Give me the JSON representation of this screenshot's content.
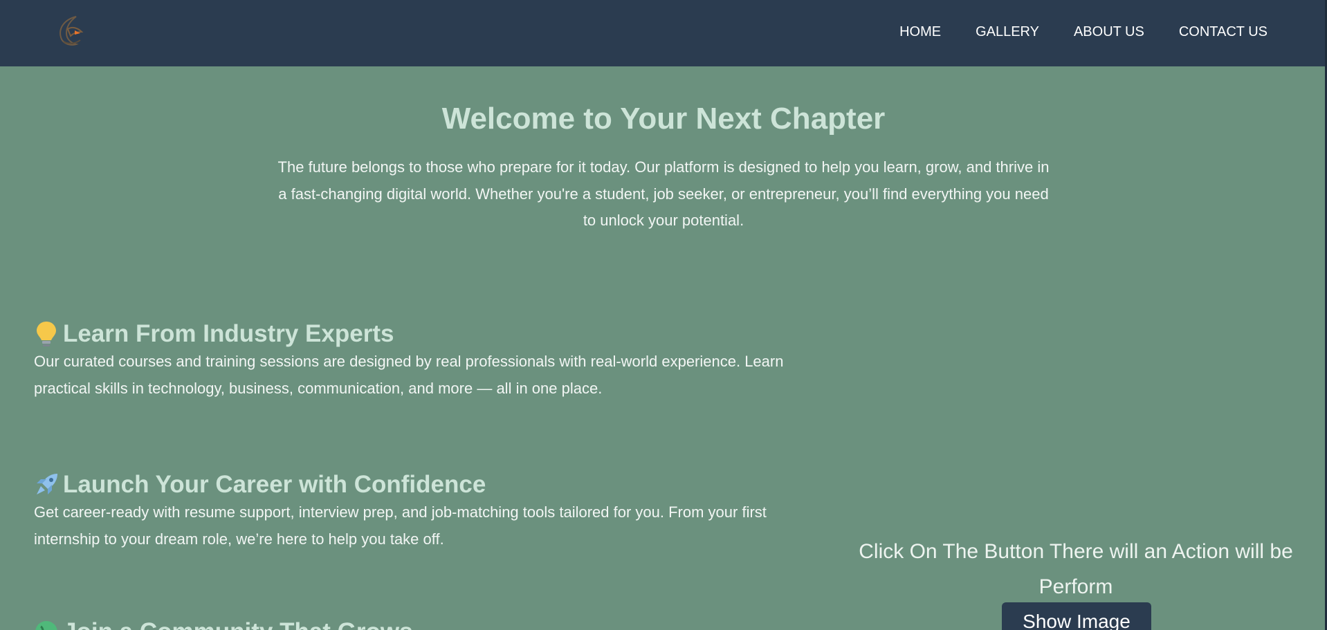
{
  "nav": {
    "items": [
      {
        "label": "HOME"
      },
      {
        "label": "GALLERY"
      },
      {
        "label": "ABOUT US"
      },
      {
        "label": "CONTACT US"
      }
    ]
  },
  "hero": {
    "title": "Welcome to Your Next Chapter",
    "text": "The future belongs to those who prepare for it today. Our platform is designed to help you learn, grow, and thrive in a fast-changing digital world. Whether you're a student, job seeker, or entrepreneur, you’ll find everything you need to unlock your potential."
  },
  "features": [
    {
      "icon": "lightbulb-icon",
      "title": "Learn From Industry Experts",
      "text": "Our curated courses and training sessions are designed by real professionals with real-world experience. Learn practical skills in technology, business, communication, and more — all in one place."
    },
    {
      "icon": "rocket-icon",
      "title": "Launch Your Career with Confidence",
      "text": "Get career-ready with resume support, interview prep, and job-matching tools tailored for you. From your first internship to your dream role, we’re here to help you take off."
    },
    {
      "icon": "globe-icon",
      "title": "Join a Community That Grows",
      "text": ""
    }
  ],
  "action": {
    "text": "Click On The Button There will an Action will be Perform",
    "button_label": "Show Image"
  },
  "colors": {
    "page_bg": "#6b917e",
    "header_bg": "#2b3c50",
    "heading": "#cde4d8",
    "body_text": "#f2f6f4"
  }
}
